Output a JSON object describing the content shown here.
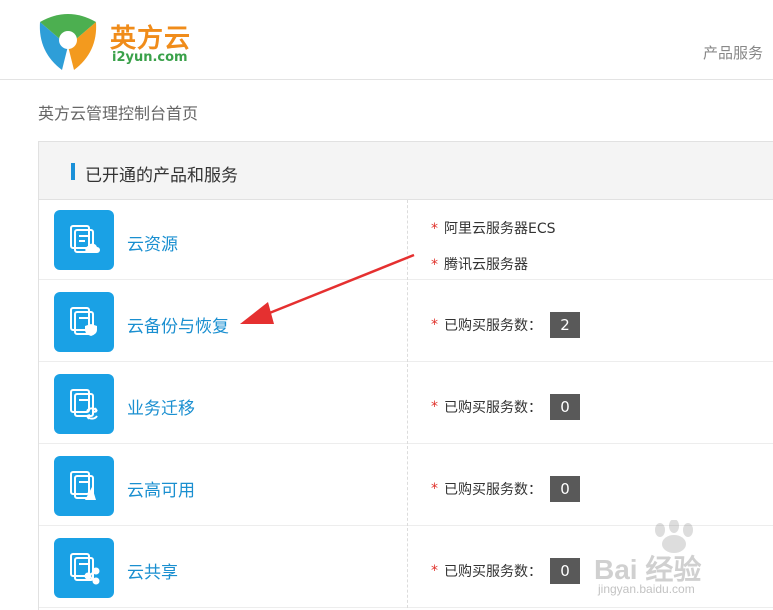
{
  "header": {
    "brand_cn": "英方云",
    "brand_en": "i2yun.com",
    "nav_products": "产品服务"
  },
  "breadcrumb": "英方云管理控制台首页",
  "panel": {
    "title": "已开通的产品和服务"
  },
  "services": [
    {
      "name": "云资源",
      "icon": "cloud-resource-icon",
      "details": [
        "阿里云服务器ECS",
        "腾讯云服务器"
      ]
    },
    {
      "name": "云备份与恢复",
      "icon": "backup-restore-icon",
      "count_label": "已购买服务数：",
      "count": "2"
    },
    {
      "name": "业务迁移",
      "icon": "migration-icon",
      "count_label": "已购买服务数：",
      "count": "0"
    },
    {
      "name": "云高可用",
      "icon": "high-availability-icon",
      "count_label": "已购买服务数：",
      "count": "0"
    },
    {
      "name": "云共享",
      "icon": "share-icon",
      "count_label": "已购买服务数：",
      "count": "0"
    }
  ],
  "watermark": {
    "text": "Bai 经验",
    "sub": "jingyan.baidu.com"
  },
  "colors": {
    "brand_orange": "#f08c1a",
    "brand_green": "#3aa14a",
    "icon_blue": "#1aa1e5",
    "link_blue": "#1a8fd0",
    "badge_gray": "#595959",
    "star_red": "#e0312a",
    "arrow_red": "#e53030"
  }
}
